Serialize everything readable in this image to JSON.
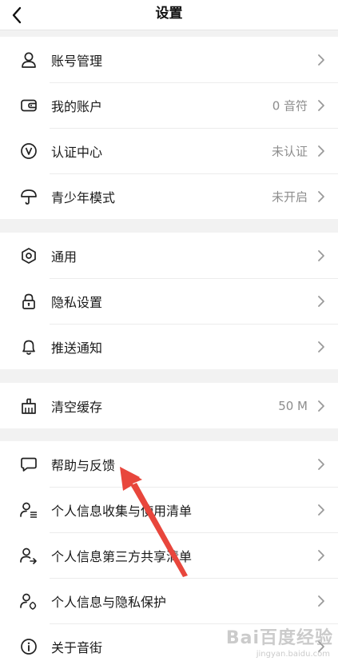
{
  "navbar": {
    "title": "设置",
    "back_icon": "chevron-left-icon"
  },
  "groups": [
    {
      "items": [
        {
          "icon": "user-icon",
          "label": "账号管理",
          "value": ""
        },
        {
          "icon": "wallet-icon",
          "label": "我的账户",
          "value": "0 音符"
        },
        {
          "icon": "verified-v-icon",
          "label": "认证中心",
          "value": "未认证"
        },
        {
          "icon": "umbrella-icon",
          "label": "青少年模式",
          "value": "未开启"
        }
      ]
    },
    {
      "items": [
        {
          "icon": "hexagon-gear-icon",
          "label": "通用",
          "value": ""
        },
        {
          "icon": "lock-icon",
          "label": "隐私设置",
          "value": ""
        },
        {
          "icon": "bell-icon",
          "label": "推送通知",
          "value": ""
        }
      ]
    },
    {
      "items": [
        {
          "icon": "broom-icon",
          "label": "清空缓存",
          "value": "50 M"
        }
      ]
    },
    {
      "items": [
        {
          "icon": "chat-bubble-icon",
          "label": "帮助与反馈",
          "value": ""
        },
        {
          "icon": "user-list-icon",
          "label": "个人信息收集与使用清单",
          "value": ""
        },
        {
          "icon": "user-share-icon",
          "label": "个人信息第三方共享清单",
          "value": ""
        },
        {
          "icon": "user-shield-icon",
          "label": "个人信息与隐私保护",
          "value": ""
        },
        {
          "icon": "info-icon",
          "label": "关于音街",
          "value": ""
        }
      ]
    }
  ],
  "annotation": {
    "arrow_color": "#e8463c",
    "points_to": "帮助与反馈"
  },
  "watermark": {
    "text": "Bai百度经验",
    "sub": "jingyan.baidu.com"
  },
  "colors": {
    "background": "#f2f2f2",
    "card": "#ffffff",
    "text": "#1a1a1a",
    "secondary_text": "#8d8d8d",
    "arrow": "#e8463c"
  }
}
